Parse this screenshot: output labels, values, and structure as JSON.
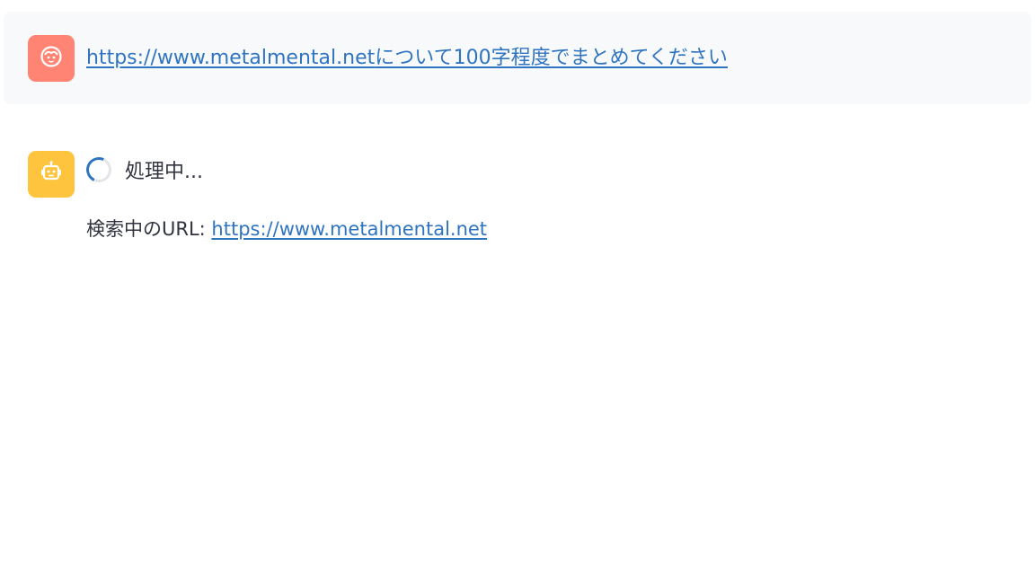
{
  "user_message": {
    "url": "https://www.metalmental.net",
    "text": "について100字程度でまとめてください",
    "avatar_icon": "user-face-icon",
    "avatar_color": "#ff8473"
  },
  "assistant_message": {
    "avatar_icon": "robot-icon",
    "avatar_color": "#ffc43e",
    "status": "処理中...",
    "detail_label": "検索中のURL: ",
    "detail_url": "https://www.metalmental.net"
  },
  "colors": {
    "link": "#2f74c0",
    "text": "#31333f",
    "user_bubble_bg": "#f8f9fb"
  }
}
